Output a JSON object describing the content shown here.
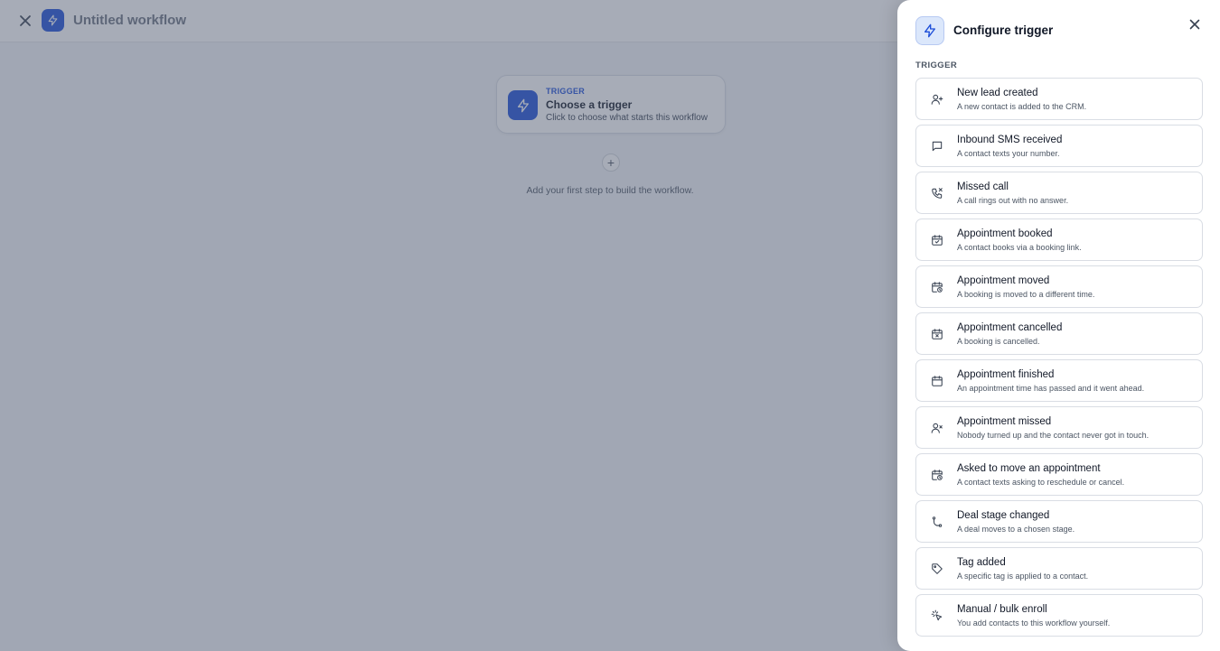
{
  "header": {
    "title": "Untitled workflow",
    "close_icon": "close-icon",
    "logo_icon": "lightning-icon"
  },
  "canvas": {
    "trigger_card": {
      "kicker": "TRIGGER",
      "title": "Choose a trigger",
      "subtitle": "Click to choose what starts this workflow"
    },
    "add_button_label": "+",
    "add_hint": "Add your first step to build the workflow."
  },
  "drawer": {
    "title": "Configure trigger",
    "section_label": "TRIGGER",
    "options": [
      {
        "title": "New lead created",
        "description": "A new contact is added to the CRM.",
        "icon": "user-plus-icon"
      },
      {
        "title": "Inbound SMS received",
        "description": "A contact texts your number.",
        "icon": "message-icon"
      },
      {
        "title": "Missed call",
        "description": "A call rings out with no answer.",
        "icon": "phone-missed-icon"
      },
      {
        "title": "Appointment booked",
        "description": "A contact books via a booking link.",
        "icon": "calendar-check-icon"
      },
      {
        "title": "Appointment moved",
        "description": "A booking is moved to a different time.",
        "icon": "calendar-clock-icon"
      },
      {
        "title": "Appointment cancelled",
        "description": "A booking is cancelled.",
        "icon": "calendar-x-icon"
      },
      {
        "title": "Appointment finished",
        "description": "An appointment time has passed and it went ahead.",
        "icon": "calendar-icon"
      },
      {
        "title": "Appointment missed",
        "description": "Nobody turned up and the contact never got in touch.",
        "icon": "user-x-icon"
      },
      {
        "title": "Asked to move an appointment",
        "description": "A contact texts asking to reschedule or cancel.",
        "icon": "calendar-clock-icon"
      },
      {
        "title": "Deal stage changed",
        "description": "A deal moves to a chosen stage.",
        "icon": "git-branch-icon"
      },
      {
        "title": "Tag added",
        "description": "A specific tag is applied to a contact.",
        "icon": "tag-icon"
      },
      {
        "title": "Manual / bulk enroll",
        "description": "You add contacts to this workflow yourself.",
        "icon": "pointer-click-icon"
      }
    ]
  },
  "colors": {
    "accent": "#1d4ed8",
    "overlay": "#4f5a70"
  }
}
